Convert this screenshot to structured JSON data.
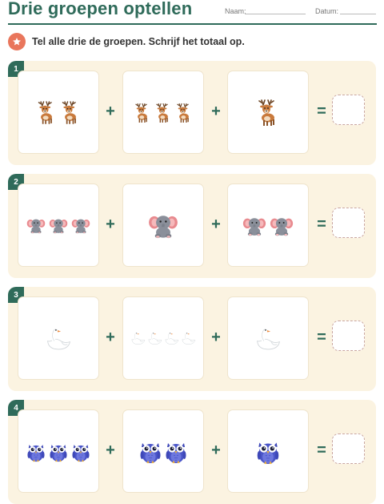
{
  "header": {
    "title": "Drie groepen optellen",
    "name_label": "Naam:",
    "date_label": "Datum:"
  },
  "instruction": {
    "icon": "star-icon",
    "text": "Tel alle drie de groepen. Schrijf het totaal op."
  },
  "colors": {
    "accent": "#2f6b5a",
    "badge": "#e9765c",
    "row_background": "#fbf3e1"
  },
  "problems": [
    {
      "number": "1",
      "animal": "deer-icon",
      "groups": [
        2,
        3,
        1
      ],
      "operators": [
        "+",
        "+",
        "="
      ],
      "answer": ""
    },
    {
      "number": "2",
      "animal": "elephant-icon",
      "groups": [
        3,
        1,
        2
      ],
      "operators": [
        "+",
        "+",
        "="
      ],
      "answer": ""
    },
    {
      "number": "3",
      "animal": "swan-icon",
      "groups": [
        1,
        4,
        1
      ],
      "operators": [
        "+",
        "+",
        "="
      ],
      "answer": ""
    },
    {
      "number": "4",
      "animal": "owl-icon",
      "groups": [
        3,
        2,
        1
      ],
      "operators": [
        "+",
        "+",
        "="
      ],
      "answer": ""
    }
  ]
}
